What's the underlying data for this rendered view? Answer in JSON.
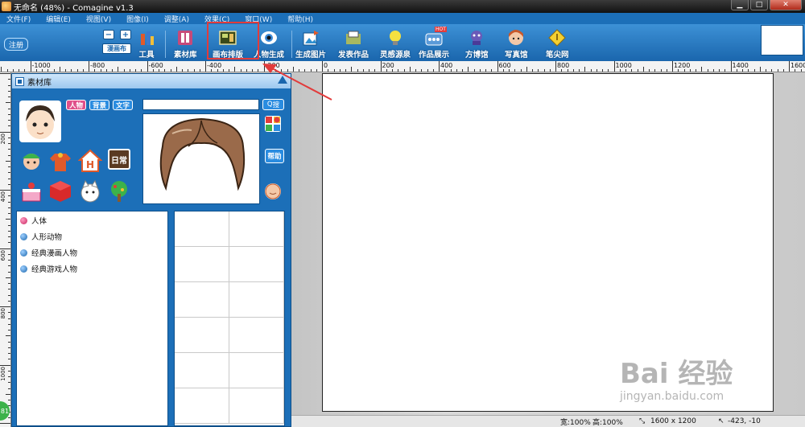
{
  "window": {
    "title": "无命名 (48%) - Comagine v1.3"
  },
  "menu": [
    "文件(F)",
    "编辑(E)",
    "视图(V)",
    "图像(I)",
    "调整(A)",
    "效果(C)",
    "窗口(W)",
    "帮助(H)"
  ],
  "toolbar": {
    "register_label": "注册",
    "zoom_minus": "−",
    "zoom_plus": "+",
    "zoom_label": "漫画布",
    "tools": [
      {
        "label": "工具",
        "icon": "tools-icon",
        "color": "#d0582b"
      },
      {
        "label": "素材库",
        "icon": "library-icon",
        "color": "#c64a7a"
      },
      {
        "label": "画布排版",
        "icon": "canvas-layout-icon",
        "color": "#4f6a2a"
      },
      {
        "label": "人物生成",
        "icon": "eye-icon",
        "color": "#3c8ad8"
      },
      {
        "label": "生成图片",
        "icon": "generate-image-icon",
        "color": "#2f8fd0"
      },
      {
        "label": "发表作品",
        "icon": "publish-icon",
        "color": "#7a8a3a"
      },
      {
        "label": "灵感源泉",
        "icon": "lightbulb-icon",
        "color": "#e8c21a"
      },
      {
        "label": "作品展示",
        "icon": "showcase-icon",
        "color": "#5a9ad8"
      },
      {
        "label": "方博馆",
        "icon": "museum-icon",
        "color": "#6a5ab8"
      },
      {
        "label": "写真馆",
        "icon": "photo-studio-icon",
        "color": "#d86a4a"
      },
      {
        "label": "笔尖网",
        "icon": "pen-tip-icon",
        "color": "#e8b81a"
      }
    ],
    "hot_badge": "HOT"
  },
  "ruler": {
    "h_labels": [
      "-1000",
      "-800",
      "-600",
      "-400",
      "-200",
      "0",
      "200",
      "400",
      "600",
      "800",
      "1000",
      "1200",
      "1400",
      "1600"
    ],
    "v_labels": [
      "200",
      "400",
      "600",
      "800",
      "1000"
    ]
  },
  "panel": {
    "title": "素材库",
    "tags": [
      "人物",
      "背景",
      "文字"
    ],
    "search_placeholder": "",
    "search_button": "搜",
    "help_button": "帮助",
    "daily_label": "日常",
    "tree": [
      {
        "label": "人体",
        "selected": true
      },
      {
        "label": "人形动物",
        "selected": false
      },
      {
        "label": "经典漫画人物",
        "selected": false
      },
      {
        "label": "经典游戏人物",
        "selected": false
      }
    ]
  },
  "status": {
    "width_zoom": "宽:100%",
    "height_zoom": "高:100%",
    "canvas_size": "1600 x 1200",
    "coords": "-423, -10"
  },
  "badge": "81",
  "watermark": {
    "brand": "Bai 经验",
    "url": "jingyan.baidu.com"
  },
  "colors": {
    "accent": "#1c6fb8",
    "highlight": "#e23b3b"
  }
}
